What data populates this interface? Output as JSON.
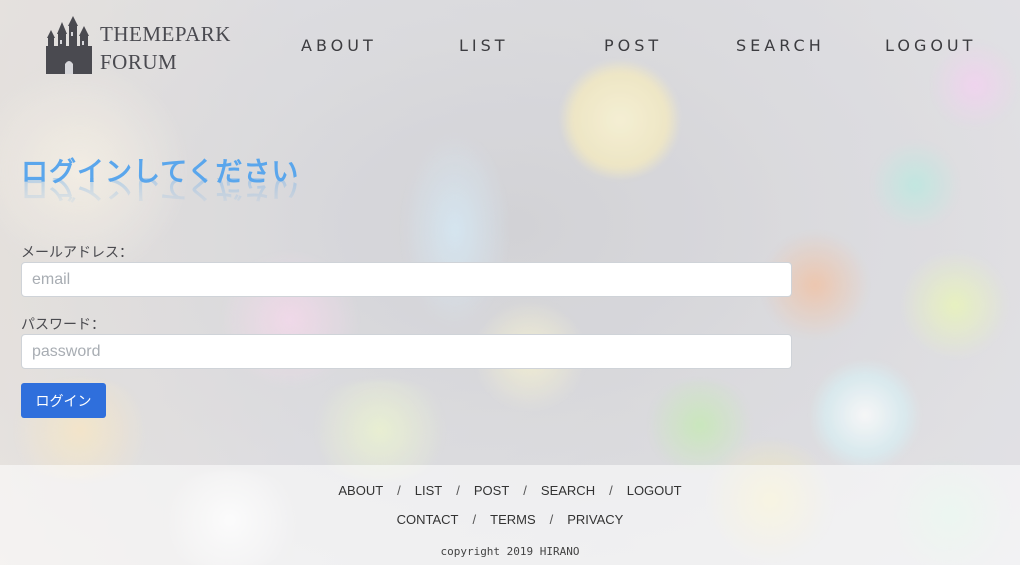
{
  "brand": {
    "line1": "THEMEPARK",
    "line2": "FORUM",
    "icon": "castle-icon"
  },
  "nav": [
    {
      "label": "ABOUT"
    },
    {
      "label": "LIST"
    },
    {
      "label": "POST"
    },
    {
      "label": "SEARCH"
    },
    {
      "label": "LOGOUT"
    }
  ],
  "login": {
    "title": "ログインしてください",
    "email_label": "メールアドレス：",
    "email_placeholder": "email",
    "email_value": "",
    "password_label": "パスワード：",
    "password_placeholder": "password",
    "password_value": "",
    "submit_label": "ログイン"
  },
  "footer": {
    "row1": [
      "ABOUT",
      "LIST",
      "POST",
      "SEARCH",
      "LOGOUT"
    ],
    "row2": [
      "CONTACT",
      "TERMS",
      "PRIVACY"
    ],
    "separator": "/",
    "copyright": "copyright 2019 HIRANO"
  },
  "colors": {
    "title": "#5aa6ec",
    "button": "#2f6fdc",
    "nav_text": "#3c3c40"
  }
}
